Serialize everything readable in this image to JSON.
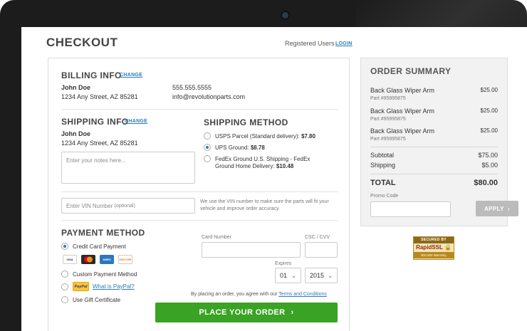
{
  "page_title": "CHECKOUT",
  "registered_users_label": "Registered Users",
  "login_link": "LOGIN",
  "billing": {
    "title": "BILLING INFO",
    "change_link": "CHANGE",
    "name": "John Doe",
    "address": "1234 Any Street, AZ 85281",
    "phone": "555.555.5555",
    "email": "info@revolutionparts.com"
  },
  "shipping": {
    "title": "SHIPPING INFO",
    "change_link": "CHANGE",
    "name": "John Doe",
    "address": "1234 Any Street, AZ 85281",
    "notes_placeholder": "Enter your notes here..."
  },
  "shipping_method": {
    "title": "SHIPPING METHOD",
    "options": [
      {
        "label": "USPS Parcel (Standard delivery): ",
        "price": "$7.80",
        "selected": false
      },
      {
        "label": "UPS Ground: ",
        "price": "$8.78",
        "selected": true
      },
      {
        "label": "FedEx Ground U.S. Shipping - FedEx Ground Home Delivery: ",
        "price": "$10.48",
        "selected": false
      }
    ]
  },
  "vin": {
    "placeholder": "Enter VIN Number",
    "optional": "(optional)",
    "help": "We use the VIN number to make sure the parts will fit your vehicle and improve order accuracy."
  },
  "payment": {
    "title": "PAYMENT METHOD",
    "options": {
      "credit_card": "Credit Card Payment",
      "custom": "Custom Payment Method",
      "paypal_badge": "PayPal",
      "paypal_link": "What is PayPal?",
      "gift": "Use Gift Certificate"
    },
    "cards": [
      "VISA",
      "MC",
      "AMEX",
      "DISCOVER"
    ],
    "card_number_label": "Card Number",
    "csc_label": "CSC / CVV",
    "expires_label": "Expires",
    "exp_month": "01",
    "exp_year": "2015",
    "terms_prefix": "By placing an order, you agree with our ",
    "terms_link": "Terms and Conditions",
    "place_order": "PLACE YOUR ORDER"
  },
  "summary": {
    "title": "ORDER SUMMARY",
    "items": [
      {
        "name": "Back Glass Wiper Arm",
        "part": "Part #95995875",
        "price": "$25.00"
      },
      {
        "name": "Back Glass Wiper Arm",
        "part": "Part #95995875",
        "price": "$25.00"
      },
      {
        "name": "Back Glass Wiper Arm",
        "part": "Part #95995875",
        "price": "$25.00"
      }
    ],
    "subtotal_label": "Subtotal",
    "subtotal": "$75.00",
    "shipping_label": "Shipping",
    "shipping": "$5.00",
    "total_label": "TOTAL",
    "total": "$80.00",
    "promo_label": "Promo Code",
    "apply": "APPLY"
  },
  "ssl_badge": {
    "top": "SECURED BY",
    "brand": "RapidSSL",
    "warranty": "$10,000 Warranty"
  },
  "colors": {
    "accent": "#2a7db8",
    "button_green": "#3aa224",
    "summary_bg": "#f2f2f2"
  }
}
